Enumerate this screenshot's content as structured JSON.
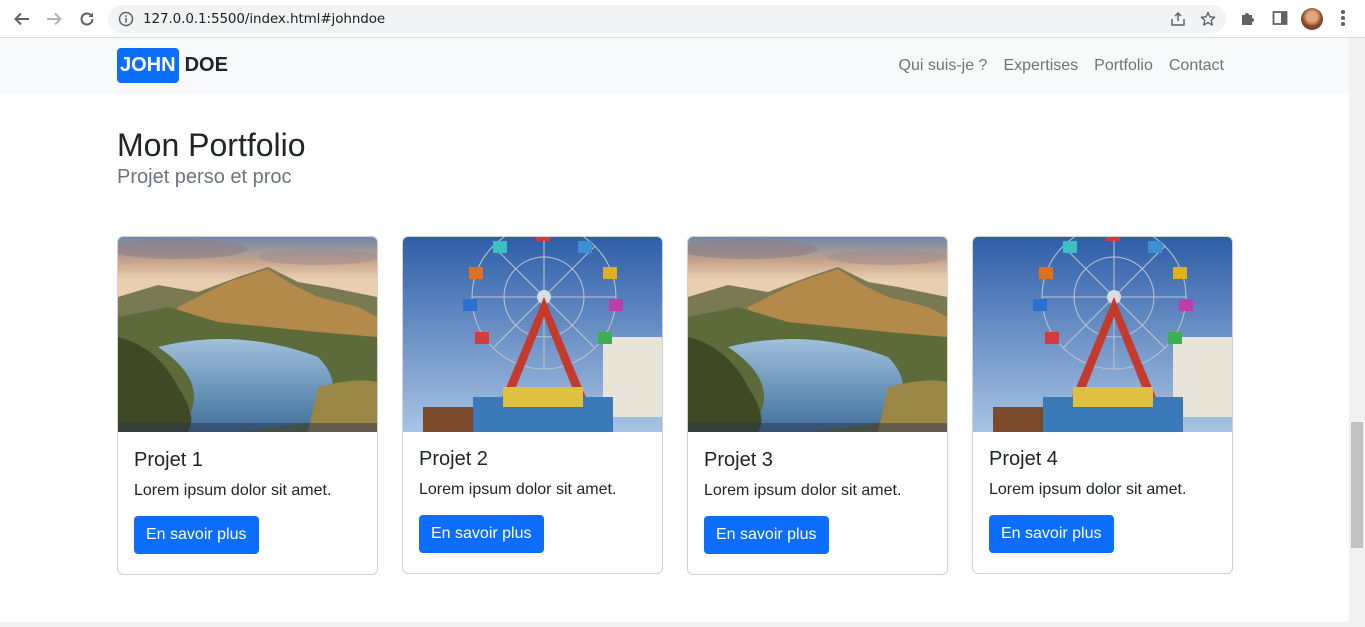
{
  "browser": {
    "url": "127.0.0.1:5500/index.html#johndoe",
    "icons": [
      "back-icon",
      "forward-icon",
      "reload-icon",
      "info-icon",
      "share-icon",
      "star-icon",
      "extensions-icon",
      "side-panel-icon",
      "profile-avatar",
      "menu-icon"
    ]
  },
  "navbar": {
    "brand_badge": "JOHN",
    "brand_rest": "DOE",
    "links": [
      "Qui suis-je ?",
      "Expertises",
      "Portfolio",
      "Contact"
    ]
  },
  "section": {
    "title": "Mon Portfolio",
    "subtitle": "Projet perso et proc"
  },
  "cards": [
    {
      "title": "Projet 1",
      "text": "Lorem ipsum dolor sit amet.",
      "button": "En savoir plus",
      "image": "lake-landscape"
    },
    {
      "title": "Projet 2",
      "text": "Lorem ipsum dolor sit amet.",
      "button": "En savoir plus",
      "image": "ferris-wheel"
    },
    {
      "title": "Projet 3",
      "text": "Lorem ipsum dolor sit amet.",
      "button": "En savoir plus",
      "image": "lake-landscape"
    },
    {
      "title": "Projet 4",
      "text": "Lorem ipsum dolor sit amet.",
      "button": "En savoir plus",
      "image": "ferris-wheel"
    }
  ],
  "colors": {
    "primary": "#0d6efd",
    "navbar_bg": "#f8f9fa",
    "text": "#212529",
    "muted": "#6c757d"
  }
}
